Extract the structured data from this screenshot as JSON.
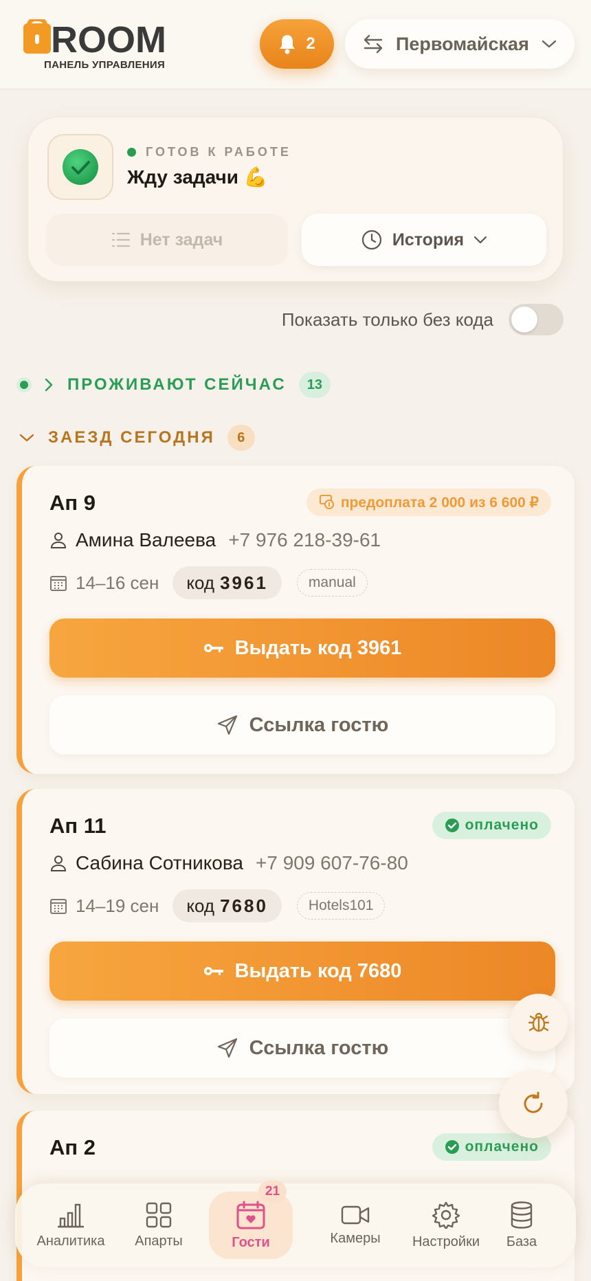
{
  "header": {
    "logo_sub": "ПАНЕЛЬ УПРАВЛЕНИЯ",
    "logo_word": "ROOM",
    "notifications_count": "2",
    "location": "Первомайская"
  },
  "status": {
    "label": "ГОТОВ К РАБОТЕ",
    "title": "Жду задачи 💪",
    "tasks_label": "Нет задач",
    "history_label": "История"
  },
  "filter": {
    "label": "Показать только без кода",
    "enabled": false
  },
  "sections": {
    "living_now": {
      "title": "ПРОЖИВАЮТ СЕЙЧАС",
      "count": "13"
    },
    "checkin_today": {
      "title": "ЗАЕЗД СЕГОДНЯ",
      "count": "6"
    }
  },
  "cards": [
    {
      "apt": "Ап 9",
      "payment": "предоплата 2 000 из 6 600 ₽",
      "payment_status": "prepaid",
      "guest": "Амина Валеева",
      "phone": "+7 976 218-39-61",
      "dates": "14–16 сен",
      "code_prefix": "код",
      "code": "3961",
      "source": "manual",
      "issue_label": "Выдать код 3961",
      "link_label": "Ссылка гостю"
    },
    {
      "apt": "Ап 11",
      "payment": "оплачено",
      "payment_status": "paid",
      "guest": "Сабина Сотникова",
      "phone": "+7 909 607-76-80",
      "dates": "14–19 сен",
      "code_prefix": "код",
      "code": "7680",
      "source": "Hotels101",
      "issue_label": "Выдать код 7680",
      "link_label": "Ссылка гостю"
    },
    {
      "apt": "Ап 2",
      "payment": "оплачено",
      "payment_status": "paid"
    }
  ],
  "nav": {
    "items": [
      {
        "label": "Аналитика",
        "icon": "bar-chart-icon"
      },
      {
        "label": "Апарты",
        "icon": "grid-icon"
      },
      {
        "label": "Гости",
        "icon": "calendar-heart-icon",
        "badge": "21",
        "active": true
      },
      {
        "label": "Камеры",
        "icon": "video-camera-icon"
      },
      {
        "label": "Настройки",
        "icon": "gear-icon"
      },
      {
        "label": "База",
        "icon": "database-icon"
      }
    ]
  },
  "colors": {
    "accent": "#f5a23c",
    "success": "#2a9d55",
    "active_nav": "#e0508a"
  }
}
